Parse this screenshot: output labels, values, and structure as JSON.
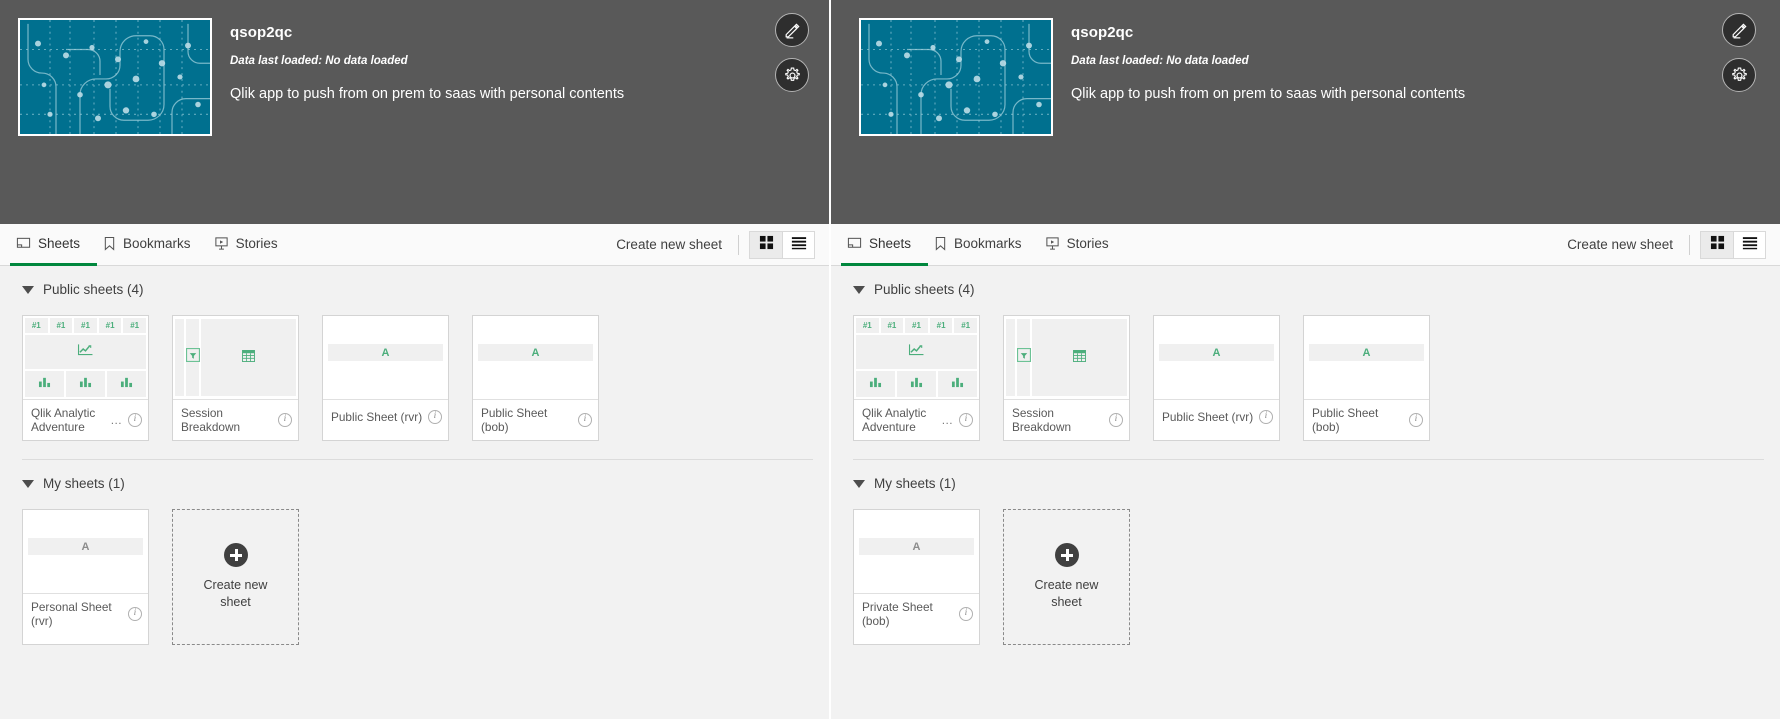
{
  "panels": [
    {
      "id": "left",
      "app": {
        "title": "qsop2qc",
        "data_last_loaded": "Data last loaded: No data loaded",
        "description": "Qlik app to push from on prem to saas with personal contents",
        "thumbnail_color": "#00708f"
      },
      "actions": [
        {
          "name": "edit-sheet-button",
          "icon": "pencil-icon",
          "tooltip": "Edit"
        },
        {
          "name": "app-settings-button",
          "icon": "gear-icon",
          "tooltip": "App settings"
        }
      ],
      "tabs": [
        {
          "label": "Sheets",
          "icon": "sheet-icon",
          "active": true
        },
        {
          "label": "Bookmarks",
          "icon": "bookmark-icon",
          "active": false
        },
        {
          "label": "Stories",
          "icon": "story-icon",
          "active": false
        }
      ],
      "create_new_sheet": "Create new sheet",
      "view_modes": [
        {
          "name": "grid-view-toggle",
          "icon": "grid-icon",
          "active": true
        },
        {
          "name": "list-view-toggle",
          "icon": "list-icon",
          "active": false
        }
      ],
      "sections": [
        {
          "heading": "Public sheets (4)",
          "sheets": [
            {
              "title": "Qlik Analytic Adventure",
              "truncated": true,
              "ellipsis": "…",
              "preview": "analytic",
              "kpis": [
                "#1",
                "#1",
                "#1",
                "#1",
                "#1"
              ]
            },
            {
              "title": "Session Breakdown",
              "truncated": false,
              "preview": "session"
            },
            {
              "title": "Public Sheet (rvr)",
              "truncated": false,
              "preview": "text",
              "letter": "A",
              "letter_color": "green"
            },
            {
              "title": "Public Sheet (bob)",
              "truncated": false,
              "preview": "text",
              "letter": "A",
              "letter_color": "green"
            }
          ]
        },
        {
          "heading": "My sheets (1)",
          "sheets": [
            {
              "title": "Personal Sheet (rvr)",
              "truncated": false,
              "preview": "text",
              "letter": "A",
              "letter_color": "gray"
            }
          ],
          "create_tile": "Create new sheet"
        }
      ]
    },
    {
      "id": "right",
      "app": {
        "title": "qsop2qc",
        "data_last_loaded": "Data last loaded: No data loaded",
        "description": "Qlik app to push from on prem to saas with personal contents",
        "thumbnail_color": "#00708f"
      },
      "actions": [
        {
          "name": "edit-sheet-button",
          "icon": "pencil-icon",
          "tooltip": "Edit"
        },
        {
          "name": "app-settings-button",
          "icon": "gear-icon",
          "tooltip": "App settings"
        }
      ],
      "tabs": [
        {
          "label": "Sheets",
          "icon": "sheet-icon",
          "active": true
        },
        {
          "label": "Bookmarks",
          "icon": "bookmark-icon",
          "active": false
        },
        {
          "label": "Stories",
          "icon": "story-icon",
          "active": false
        }
      ],
      "create_new_sheet": "Create new sheet",
      "view_modes": [
        {
          "name": "grid-view-toggle",
          "icon": "grid-icon",
          "active": true
        },
        {
          "name": "list-view-toggle",
          "icon": "list-icon",
          "active": false
        }
      ],
      "sections": [
        {
          "heading": "Public sheets (4)",
          "sheets": [
            {
              "title": "Qlik Analytic Adventure",
              "truncated": true,
              "ellipsis": "…",
              "preview": "analytic",
              "kpis": [
                "#1",
                "#1",
                "#1",
                "#1",
                "#1"
              ]
            },
            {
              "title": "Session Breakdown",
              "truncated": false,
              "preview": "session"
            },
            {
              "title": "Public Sheet (rvr)",
              "truncated": false,
              "preview": "text",
              "letter": "A",
              "letter_color": "green"
            },
            {
              "title": "Public Sheet (bob)",
              "truncated": false,
              "preview": "text",
              "letter": "A",
              "letter_color": "green"
            }
          ]
        },
        {
          "heading": "My sheets (1)",
          "sheets": [
            {
              "title": "Private Sheet (bob)",
              "truncated": false,
              "preview": "text",
              "letter": "A",
              "letter_color": "gray"
            }
          ],
          "create_tile": "Create new sheet"
        }
      ]
    }
  ],
  "colors": {
    "accent_green": "#00873d",
    "header_dark": "#595959",
    "thumb_teal": "#00708f",
    "chart_green": "#4cae7c"
  }
}
